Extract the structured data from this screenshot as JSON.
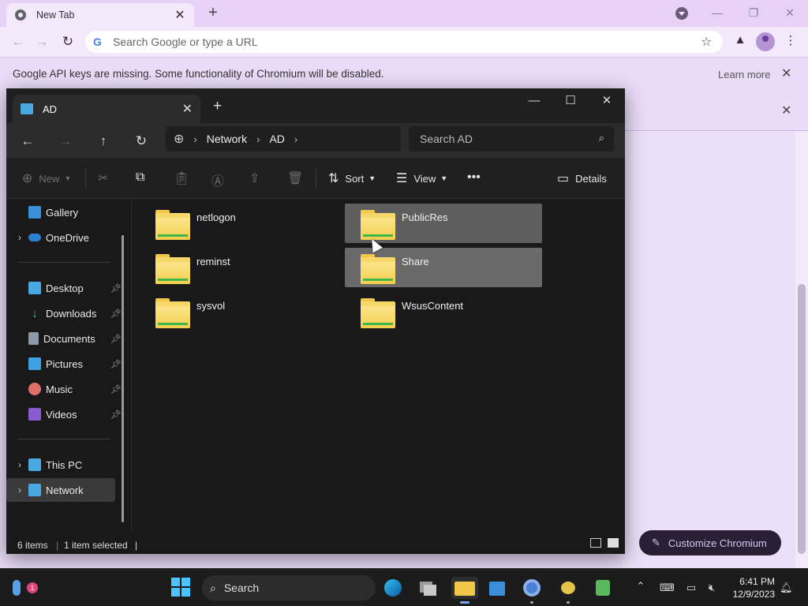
{
  "chrome": {
    "tab_title": "New Tab",
    "omnibox_placeholder": "Search Google or type a URL",
    "infobar_text": "Google API keys are missing. Some functionality of Chromium will be disabled.",
    "infobar_learn_more": "Learn more",
    "customize_label": "Customize Chromium"
  },
  "explorer": {
    "tab_title": "AD",
    "breadcrumb": [
      "Network",
      "AD"
    ],
    "search_placeholder": "Search AD",
    "commands": {
      "new": "New",
      "sort": "Sort",
      "view": "View",
      "details": "Details"
    },
    "nav": {
      "gallery": "Gallery",
      "onedrive": "OneDrive",
      "desktop": "Desktop",
      "downloads": "Downloads",
      "documents": "Documents",
      "pictures": "Pictures",
      "music": "Music",
      "videos": "Videos",
      "this_pc": "This PC",
      "network": "Network"
    },
    "folders": [
      {
        "name": "netlogon"
      },
      {
        "name": "PublicRes"
      },
      {
        "name": "reminst"
      },
      {
        "name": "Share"
      },
      {
        "name": "sysvol"
      },
      {
        "name": "WsusContent"
      }
    ],
    "status": {
      "count": "6 items",
      "selection": "1 item selected",
      "cursor": "|"
    }
  },
  "taskbar": {
    "search_label": "Search",
    "time": "6:41 PM",
    "date": "12/9/2023",
    "notification_badge": "1"
  },
  "colors": {
    "chrome_accent": "#e7d2f5",
    "explorer_bg": "#191919",
    "folder_yellow": "#f7d868",
    "selection": "#6a6a6a"
  }
}
